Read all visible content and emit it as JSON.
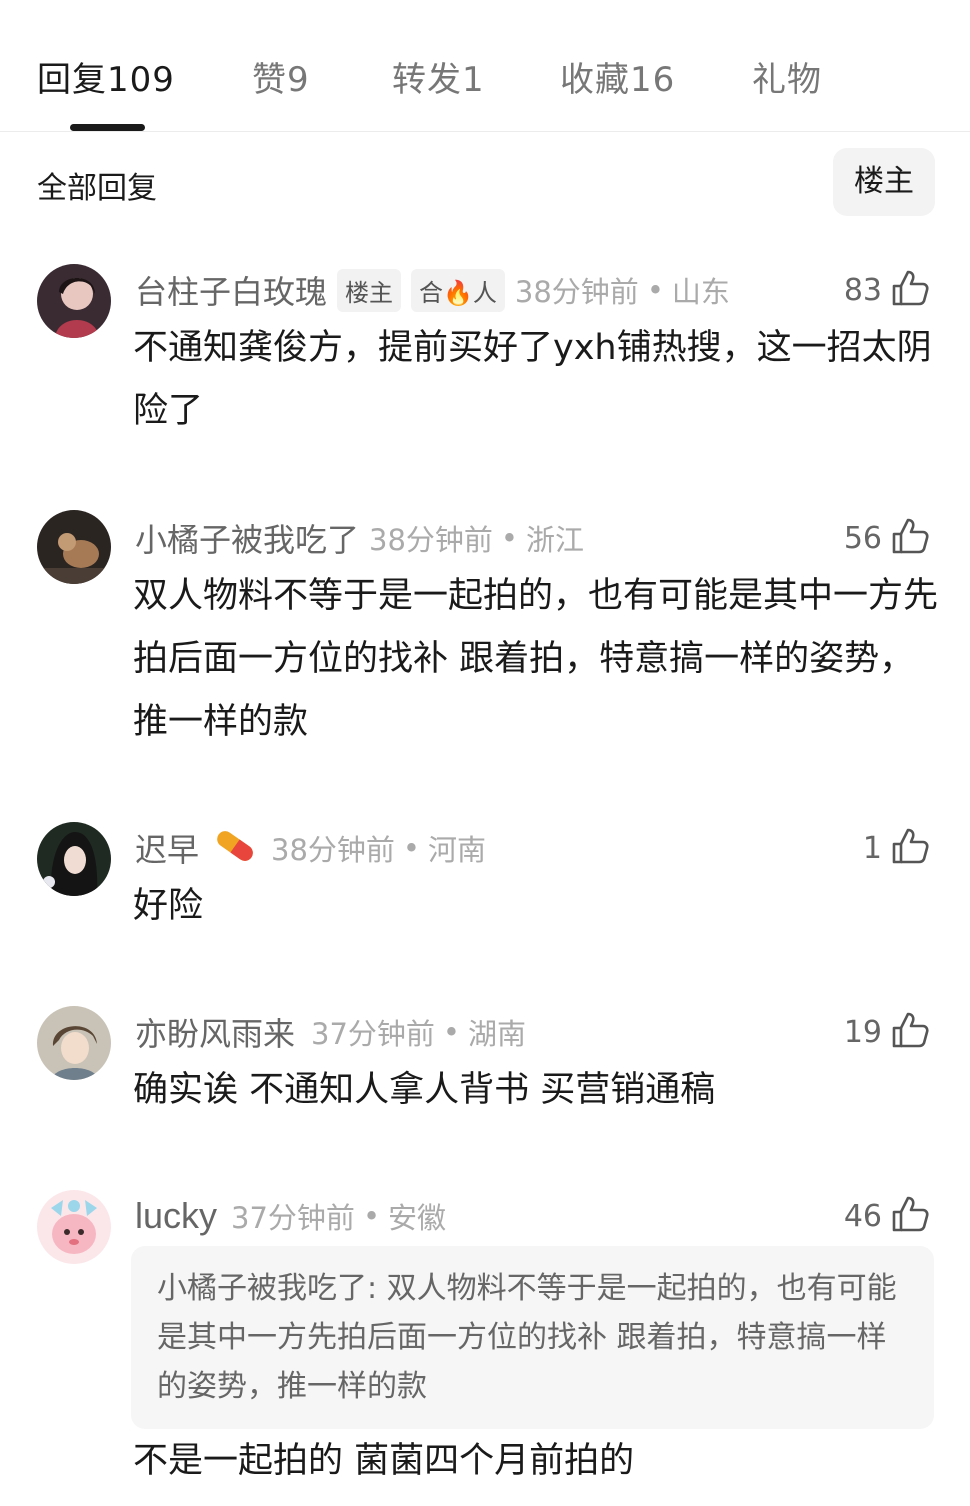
{
  "tabs": [
    {
      "label": "回复",
      "count": "109"
    },
    {
      "label": "赞",
      "count": "9"
    },
    {
      "label": "转发",
      "count": "1"
    },
    {
      "label": "收藏",
      "count": "16"
    },
    {
      "label": "礼物",
      "count": ""
    }
  ],
  "section": {
    "title": "全部回复",
    "filter_button": "楼主"
  },
  "comments": [
    {
      "username": "台柱子白玫瑰",
      "badges": [
        "楼主",
        "合🔥人"
      ],
      "time": "38分钟前",
      "region": "山东",
      "likes": "83",
      "text": "不通知龚俊方，提前买好了yxh铺热搜，这一招太阴险了"
    },
    {
      "username": "小橘子被我吃了",
      "time": "38分钟前",
      "region": "浙江",
      "likes": "56",
      "text": "双人物料不等于是一起拍的，也有可能是其中一方先拍后面一方位的找补 跟着拍，特意搞一样的姿势，推一样的款"
    },
    {
      "username": "迟早",
      "time": "38分钟前",
      "region": "河南",
      "likes": "1",
      "text": "好险"
    },
    {
      "username": "亦盼风雨来",
      "time": "37分钟前",
      "region": "湖南",
      "likes": "19",
      "text": "确实诶 不通知人拿人背书 买营销通稿"
    },
    {
      "username": "lucky",
      "time": "37分钟前",
      "region": "安徽",
      "likes": "46",
      "quote": "小橘子被我吃了: 双人物料不等于是一起拍的，也有可能是其中一方先拍后面一方位的找补 跟着拍，特意搞一样的姿势，推一样的款",
      "text": "不是一起拍的 菌菌四个月前拍的"
    }
  ],
  "colors": {
    "text_primary": "#1a1a1a",
    "text_secondary": "#666666",
    "text_meta": "#aaaaaa",
    "indicator": "#1a1a1a",
    "quote_bg": "#f6f6f6"
  }
}
